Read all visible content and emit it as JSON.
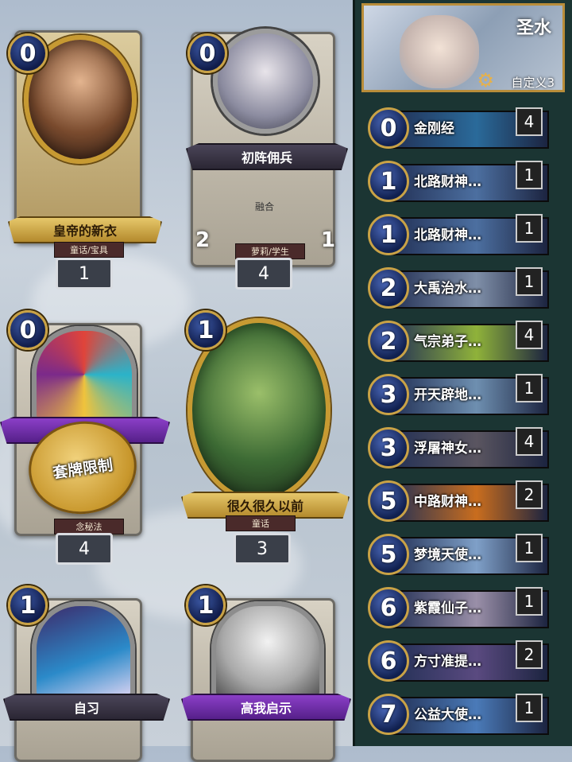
{
  "collection": {
    "cards": [
      {
        "cost": "0",
        "name": "皇帝的新衣",
        "tag": "童话/宝具",
        "count": "1",
        "style": "gold"
      },
      {
        "cost": "0",
        "name": "初阵佣兵",
        "tag": "萝莉/学生",
        "count": "4",
        "style": "dark",
        "text": "融合",
        "attack": "2",
        "health": "1"
      },
      {
        "cost": "0",
        "name": "",
        "tag": "念秘法",
        "count": "4",
        "style": "purple",
        "stamp": "套牌限制"
      },
      {
        "cost": "1",
        "name": "很久很久以前",
        "tag": "童话",
        "count": "3",
        "style": "gold"
      },
      {
        "cost": "1",
        "name": "自习",
        "style": "dark"
      },
      {
        "cost": "1",
        "name": "高我启示",
        "style": "purple"
      }
    ]
  },
  "deck": {
    "title": "圣水",
    "subtitle": "自定义3",
    "rows": [
      {
        "cost": "0",
        "name": "金刚经",
        "count": "4",
        "color": "#2a6a9a"
      },
      {
        "cost": "1",
        "name": "北路财神…",
        "count": "1",
        "color": "#4c6fa0"
      },
      {
        "cost": "1",
        "name": "北路财神…",
        "count": "1",
        "color": "#4c6fa0"
      },
      {
        "cost": "2",
        "name": "大禹治水…",
        "count": "1",
        "color": "#7f8fa8"
      },
      {
        "cost": "2",
        "name": "气宗弟子…",
        "count": "4",
        "color": "#8fb23a"
      },
      {
        "cost": "3",
        "name": "开天辟地…",
        "count": "1",
        "color": "#6e8fb0"
      },
      {
        "cost": "3",
        "name": "浮屠神女…",
        "count": "4",
        "color": "#5a5560"
      },
      {
        "cost": "5",
        "name": "中路财神…",
        "count": "2",
        "color": "#c96d1e"
      },
      {
        "cost": "5",
        "name": "梦境天使…",
        "count": "1",
        "color": "#7fa0c8"
      },
      {
        "cost": "6",
        "name": "紫霞仙子…",
        "count": "1",
        "color": "#9a8fa8"
      },
      {
        "cost": "6",
        "name": "方寸准提…",
        "count": "2",
        "color": "#5a4a80"
      },
      {
        "cost": "7",
        "name": "公益大使…",
        "count": "1",
        "color": "#4a7ab8"
      }
    ]
  },
  "colors": {
    "sidebar": "#1b3533",
    "gold": "#c9a246",
    "gem": "#1d2f6e"
  }
}
